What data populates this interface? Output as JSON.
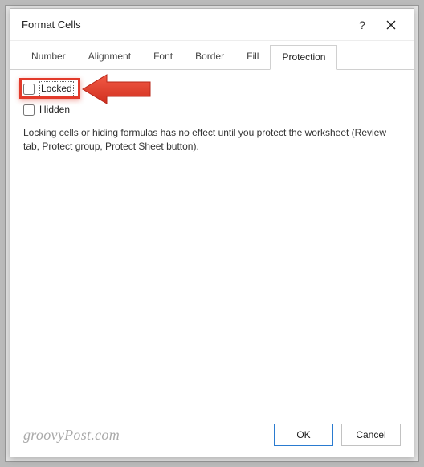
{
  "dialog": {
    "title": "Format Cells",
    "helpGlyph": "?",
    "tabs": [
      {
        "label": "Number"
      },
      {
        "label": "Alignment"
      },
      {
        "label": "Font"
      },
      {
        "label": "Border"
      },
      {
        "label": "Fill"
      },
      {
        "label": "Protection",
        "active": true
      }
    ],
    "protection": {
      "lockedLabel": "Locked",
      "hiddenLabel": "Hidden",
      "hint": "Locking cells or hiding formulas has no effect until you protect the worksheet (Review tab, Protect group, Protect Sheet button)."
    },
    "buttons": {
      "ok": "OK",
      "cancel": "Cancel"
    }
  },
  "watermark": "groovyPost.com",
  "annotation": {
    "highlightColor": "#e23a2a"
  }
}
